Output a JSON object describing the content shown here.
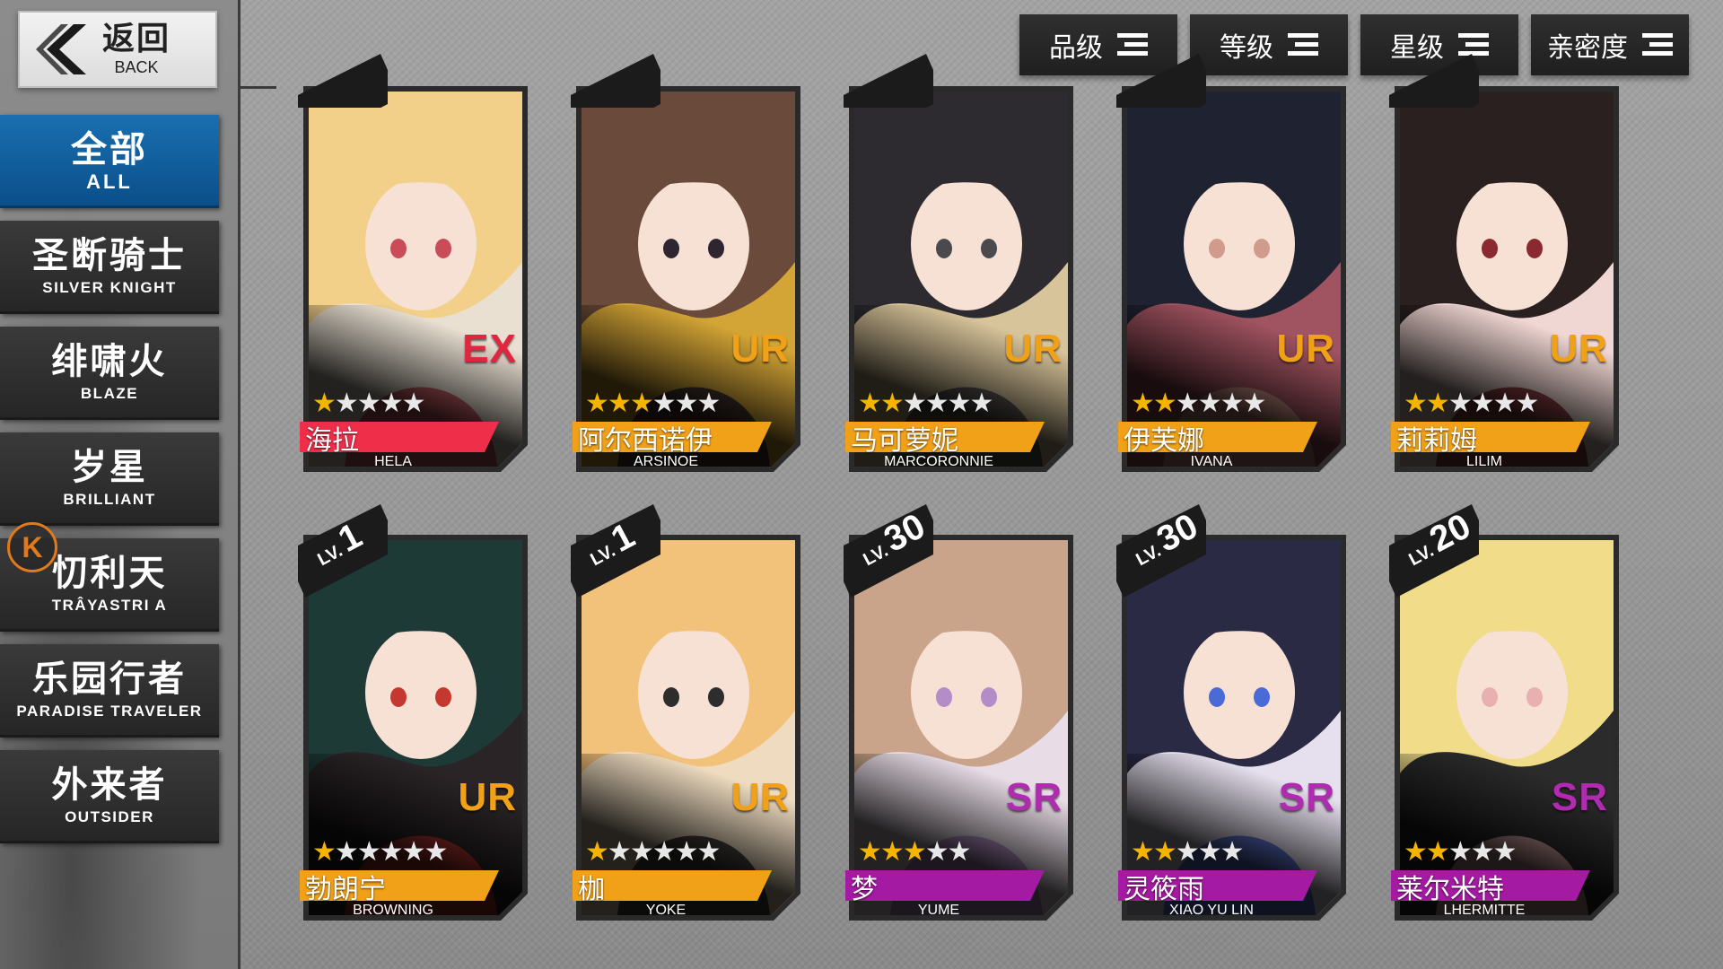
{
  "back": {
    "zh": "返回",
    "en": "BACK"
  },
  "categories": [
    {
      "zh": "全部",
      "en": "ALL",
      "active": true
    },
    {
      "zh": "圣断骑士",
      "en": "SILVER KNIGHT",
      "active": false
    },
    {
      "zh": "绯啸火",
      "en": "BLAZE",
      "active": false
    },
    {
      "zh": "岁星",
      "en": "BRILLIANT",
      "active": false
    },
    {
      "zh": "忉利天",
      "en": "TRÂYASTRI A",
      "active": false
    },
    {
      "zh": "乐园行者",
      "en": "PARADISE TRAVELER",
      "active": false
    },
    {
      "zh": "外来者",
      "en": "OUTSIDER",
      "active": false
    }
  ],
  "k_badge": "K",
  "sort_buttons": [
    "品级",
    "等级",
    "星级",
    "亲密度"
  ],
  "lv_prefix": "LV.",
  "characters": [
    {
      "zh": "海拉",
      "en": "HELA",
      "rarity": "EX",
      "stars": 1,
      "max_stars": 5,
      "level": "",
      "color": "#ef2f4a",
      "rarity_color": "#e3263f",
      "palette": [
        "#f3d08a",
        "#e9e0d2",
        "#c94c58"
      ]
    },
    {
      "zh": "阿尔西诺伊",
      "en": "ARSINOE",
      "rarity": "UR",
      "stars": 3,
      "max_stars": 6,
      "level": "",
      "color": "#f0a118",
      "rarity_color": "#f0a118",
      "palette": [
        "#6a4a3a",
        "#d3a536",
        "#2f2530"
      ]
    },
    {
      "zh": "马可萝妮",
      "en": "MARCORONNIE",
      "rarity": "UR",
      "stars": 2,
      "max_stars": 6,
      "level": "",
      "color": "#f0a118",
      "rarity_color": "#f0a118",
      "palette": [
        "#2d2b30",
        "#d8c49a",
        "#4a4a4e"
      ]
    },
    {
      "zh": "伊芙娜",
      "en": "IVANA",
      "rarity": "UR",
      "stars": 2,
      "max_stars": 6,
      "level": "",
      "color": "#f0a118",
      "rarity_color": "#f0a118",
      "palette": [
        "#1f2230",
        "#a05360",
        "#d09a8c"
      ]
    },
    {
      "zh": "莉莉姆",
      "en": "LILIM",
      "rarity": "UR",
      "stars": 2,
      "max_stars": 6,
      "level": "",
      "color": "#f0a118",
      "rarity_color": "#f0a118",
      "palette": [
        "#2b2020",
        "#f1d7d3",
        "#8a2a30"
      ]
    },
    {
      "zh": "勃朗宁",
      "en": "BROWNING",
      "rarity": "UR",
      "stars": 1,
      "max_stars": 6,
      "level": "1",
      "color": "#f0a118",
      "rarity_color": "#f0a118",
      "palette": [
        "#1e3a36",
        "#2a2426",
        "#c43830"
      ]
    },
    {
      "zh": "枷",
      "en": "YOKE",
      "rarity": "UR",
      "stars": 1,
      "max_stars": 6,
      "level": "1",
      "color": "#f0a118",
      "rarity_color": "#f0a118",
      "palette": [
        "#f3c27a",
        "#efdcc0",
        "#2d2d2d"
      ]
    },
    {
      "zh": "梦",
      "en": "YUME",
      "rarity": "SR",
      "stars": 3,
      "max_stars": 5,
      "level": "30",
      "color": "#a51aa3",
      "rarity_color": "#b02bb0",
      "palette": [
        "#c9a48a",
        "#e8dce6",
        "#b48cc8"
      ]
    },
    {
      "zh": "灵筱雨",
      "en": "XIAO YU LIN",
      "rarity": "SR",
      "stars": 2,
      "max_stars": 5,
      "level": "30",
      "color": "#a51aa3",
      "rarity_color": "#b02bb0",
      "palette": [
        "#2a2a44",
        "#e6e0ee",
        "#4a6ad8"
      ]
    },
    {
      "zh": "莱尔米特",
      "en": "LHERMITTE",
      "rarity": "SR",
      "stars": 2,
      "max_stars": 5,
      "level": "20",
      "color": "#a51aa3",
      "rarity_color": "#b02bb0",
      "palette": [
        "#f1dc8a",
        "#2b2b2b",
        "#e8b0b0"
      ]
    }
  ]
}
